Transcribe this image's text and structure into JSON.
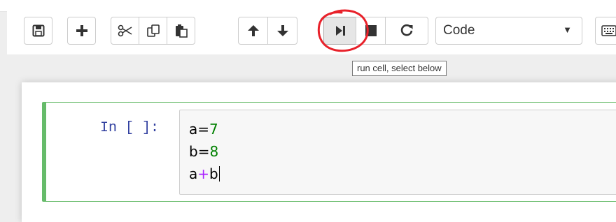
{
  "toolbar": {
    "buttons": [
      {
        "icon": "save-icon"
      },
      {
        "icon": "plus-icon"
      },
      {
        "icon": "cut-icon"
      },
      {
        "icon": "copy-icon"
      },
      {
        "icon": "paste-icon"
      },
      {
        "icon": "arrow-up-icon"
      },
      {
        "icon": "arrow-down-icon"
      },
      {
        "icon": "run-next-icon"
      },
      {
        "icon": "stop-icon"
      },
      {
        "icon": "restart-icon"
      },
      {
        "icon": "keyboard-icon"
      }
    ],
    "cell_type": "Code",
    "tooltip": "run cell, select below",
    "highlight_color": "#e8212a"
  },
  "cell": {
    "prompt": "In [ ]:",
    "code": [
      {
        "var": "a",
        "eq": "=",
        "value": "7"
      },
      {
        "var": "b",
        "eq": "=",
        "value": "8"
      },
      {
        "left": "a",
        "op": "+",
        "right": "b"
      }
    ],
    "border_color": "#66bb6a"
  }
}
